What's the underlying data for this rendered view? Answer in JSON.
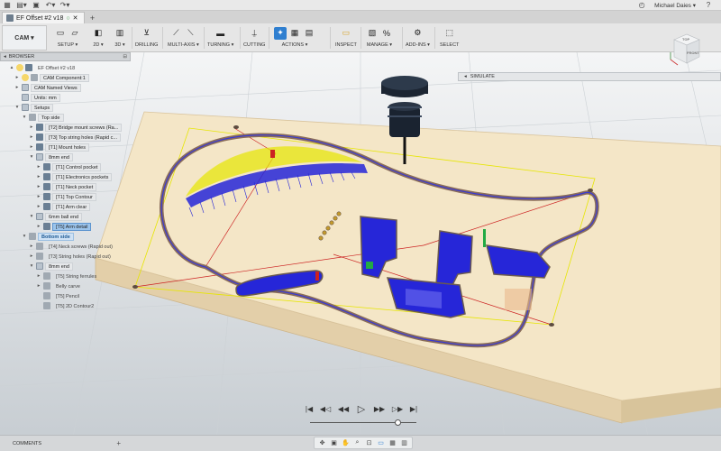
{
  "appbar": {
    "user_name": "Michael Daies ▾",
    "icons": [
      "grid-icon",
      "file-icon",
      "save-icon",
      "undo-icon",
      "redo-icon",
      "clock-icon",
      "help-icon"
    ]
  },
  "tab": {
    "title": "EF Offset #2 v18",
    "add_label": "+"
  },
  "ribbon": {
    "workspace": "CAM ▾",
    "groups": [
      {
        "label": "SETUP ▾"
      },
      {
        "label": "2D ▾"
      },
      {
        "label": "3D ▾"
      },
      {
        "label": "DRILLING"
      },
      {
        "label": "MULTI-AXIS ▾"
      },
      {
        "label": "TURNING ▾"
      },
      {
        "label": "CUTTING"
      },
      {
        "label": "ACTIONS ▾"
      },
      {
        "label": "INSPECT"
      },
      {
        "label": "MANAGE ▾"
      },
      {
        "label": "ADD-INS ▾"
      },
      {
        "label": "SELECT"
      }
    ]
  },
  "browser": {
    "title": "BROWSER",
    "nodes": [
      {
        "label": "EF Offset #2 v18"
      },
      {
        "label": "CAM Component:1"
      },
      {
        "label": "CAM Named Views"
      },
      {
        "label": "Units: mm"
      },
      {
        "label": "Setups"
      },
      {
        "label": "Top side"
      },
      {
        "label": "[T2] Bridge mount screws (Ra..."
      },
      {
        "label": "[T3] Top string holes (Rapid c..."
      },
      {
        "label": "[T1] Mount holes"
      },
      {
        "label": "8mm end"
      },
      {
        "label": "[T1] Control pocket"
      },
      {
        "label": "[T1] Electronics pockets"
      },
      {
        "label": "[T1] Neck pocket"
      },
      {
        "label": "[T1] Top Contour"
      },
      {
        "label": "[T1] Arm clear"
      },
      {
        "label": "6mm ball end"
      },
      {
        "label": "[T5] Arm detail"
      },
      {
        "label": "Bottom side"
      },
      {
        "label": "[T4] Neck screws (Rapid out)"
      },
      {
        "label": "[T3] String holes (Rapid out)"
      },
      {
        "label": "8mm end"
      },
      {
        "label": "[T5] String ferrules"
      },
      {
        "label": "Belly carve"
      },
      {
        "label": "[T5] Pencil"
      },
      {
        "label": "[T5] 2D Contour2"
      }
    ]
  },
  "simulate": {
    "label": "SIMULATE"
  },
  "viewcube": {
    "top": "TOP",
    "front": "FRONT"
  },
  "playback": {
    "buttons": [
      "skip-start",
      "step-back",
      "rewind",
      "play",
      "fast-forward",
      "step-forward",
      "skip-end"
    ],
    "position": 0.83
  },
  "bottombar": {
    "comments_label": "COMMENTS",
    "comments_add": "+"
  },
  "colors": {
    "stock": "#f2e3c3",
    "toolpath_blue": "#1f22d8",
    "toolpath_yellow": "#e6e600",
    "rapid_red": "#cc2222",
    "accent": "#2f7fd0"
  }
}
